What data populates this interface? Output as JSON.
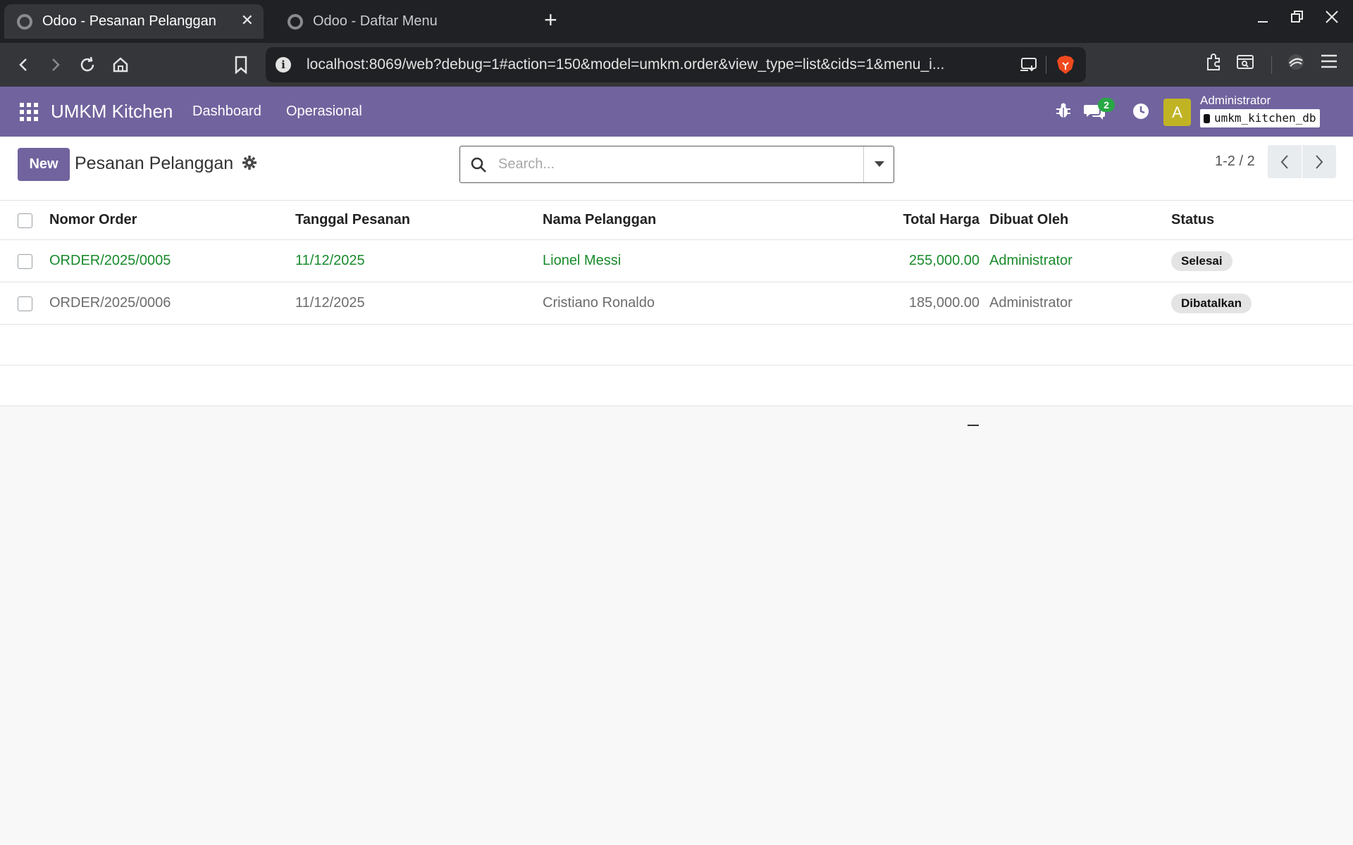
{
  "browser": {
    "tabs": [
      {
        "title": "Odoo - Pesanan Pelanggan",
        "active": true
      },
      {
        "title": "Odoo - Daftar Menu",
        "active": false
      }
    ],
    "close_glyph": "✕",
    "new_tab_glyph": "+",
    "url": "localhost:8069/web?debug=1#action=150&model=umkm.order&view_type=list&cids=1&menu_i..."
  },
  "navbar": {
    "brand": "UMKM Kitchen",
    "menu": [
      "Dashboard",
      "Operasional"
    ],
    "messages_count": "2",
    "avatar_letter": "A",
    "user_name": "Administrator",
    "database": "umkm_kitchen_db",
    "accent_color": "#71639e"
  },
  "control_panel": {
    "new_label": "New",
    "title": "Pesanan Pelanggan",
    "search_placeholder": "Search...",
    "pager": "1-2 / 2"
  },
  "list": {
    "columns": [
      "Nomor Order",
      "Tanggal Pesanan",
      "Nama Pelanggan",
      "Total Harga",
      "Dibuat Oleh",
      "Status"
    ],
    "rows": [
      {
        "order": "ORDER/2025/0005",
        "date": "11/12/2025",
        "customer": "Lionel Messi",
        "total": "255,000.00",
        "created_by": "Administrator",
        "status": "Selesai",
        "color": "#198a2c"
      },
      {
        "order": "ORDER/2025/0006",
        "date": "11/12/2025",
        "customer": "Cristiano Ronaldo",
        "total": "185,000.00",
        "created_by": "Administrator",
        "status": "Dibatalkan",
        "color": "#6c6c6c"
      }
    ]
  }
}
